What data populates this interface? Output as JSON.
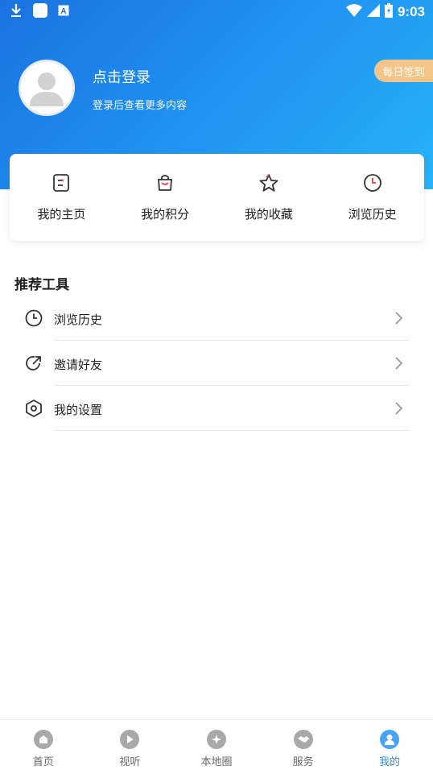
{
  "colors": {
    "header_start": "#1a72e0",
    "header_end": "#27b3f7",
    "checkin_bg": "#f3c588",
    "accent": "#e8404a",
    "tab_active": "#1e8ff0"
  },
  "status_bar": {
    "time": "9:03",
    "left_icons": [
      "download-icon",
      "notification-app-icon",
      "keyboard-a-icon"
    ],
    "right_icons": [
      "wifi-icon",
      "signal-icon",
      "battery-icon"
    ]
  },
  "profile": {
    "login_label": "点击登录",
    "login_sub": "登录后查看更多内容",
    "checkin_label": "每日签到"
  },
  "quick_actions": [
    {
      "label": "我的主页",
      "icon": "homepage-card-icon"
    },
    {
      "label": "我的积分",
      "icon": "shopping-bag-icon"
    },
    {
      "label": "我的收藏",
      "icon": "star-icon"
    },
    {
      "label": "浏览历史",
      "icon": "clock-icon"
    }
  ],
  "tools": {
    "title": "推荐工具",
    "items": [
      {
        "label": "浏览历史",
        "icon": "clock-icon"
      },
      {
        "label": "邀请好友",
        "icon": "share-arrow-icon"
      },
      {
        "label": "我的设置",
        "icon": "settings-hex-icon"
      }
    ]
  },
  "tab_bar": {
    "active_index": 4,
    "tabs": [
      {
        "label": "首页",
        "icon": "home-icon"
      },
      {
        "label": "视听",
        "icon": "play-icon"
      },
      {
        "label": "本地圈",
        "icon": "compass-icon"
      },
      {
        "label": "服务",
        "icon": "handshake-icon"
      },
      {
        "label": "我的",
        "icon": "user-icon"
      }
    ]
  }
}
